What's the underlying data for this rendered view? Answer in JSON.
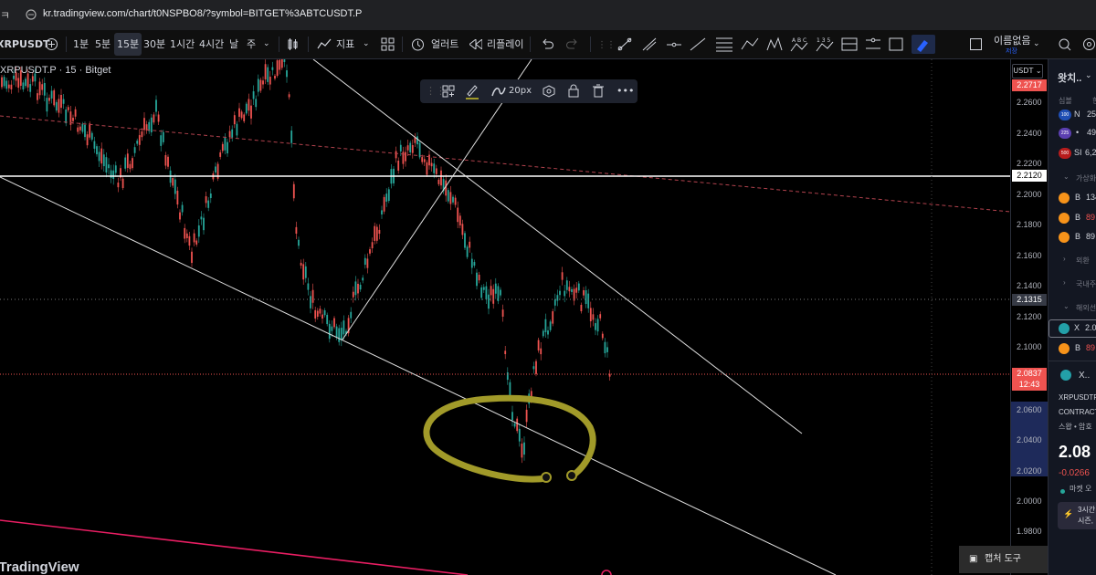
{
  "browser": {
    "back": "ㅋ",
    "url": "kr.tradingview.com/chart/t0NSPBO8/?symbol=BITGET%3ABTCUSDT.P"
  },
  "toolbar": {
    "symbol": "XRPUSDT",
    "intervals": [
      "1분",
      "5분",
      "15분",
      "30분",
      "1시간",
      "4시간",
      "날",
      "주"
    ],
    "selected_interval": "15분",
    "indicators_label": "지표",
    "alert_label": "얼러트",
    "replay_label": "리플레이",
    "layout_name": "이름없음",
    "layout_sub": "저장"
  },
  "chart": {
    "title": "XRPUSDT.P · 15 · Bitget",
    "currency": "USDT",
    "floating_toolbar": {
      "width_label": "20px"
    },
    "axis_ticks": [
      "2.2600",
      "2.2400",
      "2.2200",
      "2.2000",
      "2.1800",
      "2.1600",
      "2.1400",
      "2.1200",
      "2.1000",
      "2.0600",
      "2.0400",
      "2.0200",
      "2.0000",
      "1.9800"
    ],
    "price_labels": {
      "top": "2.2717",
      "hline": "2.2120",
      "crosshair": "2.1315",
      "last": "2.0837",
      "countdown": "12:43"
    },
    "colors": {
      "up": "#26a69a",
      "down": "#ef5350",
      "highlight": "#a19a29",
      "hline": "#ffffff",
      "dashed": "#b2424d",
      "pink": "#e91e63"
    }
  },
  "watchlist": {
    "title": "왓치..",
    "column": "심볼",
    "index_rows": [
      {
        "badge": "100",
        "sym": "N",
        "val": "25"
      },
      {
        "badge": "225",
        "sym": "•",
        "val": "49"
      },
      {
        "badge": "500",
        "sym": "SI",
        "val": "6,2"
      }
    ],
    "section_virtual": "가상화",
    "crypto_rows": [
      {
        "sym": "B",
        "val": "134"
      },
      {
        "sym": "B",
        "val": "89"
      },
      {
        "sym": "B",
        "val": "89"
      }
    ],
    "section_fx": "외환",
    "section_domestic": "국내주",
    "section_foreign": "해외선",
    "foreign_rows": [
      {
        "sym": "X",
        "val": "2.0"
      },
      {
        "sym": "B",
        "val": "89"
      }
    ],
    "detail": {
      "sym": "X..",
      "name": "XRPUSDTP",
      "type": "CONTRACT",
      "exchange": "스왑 • 암호",
      "price": "2.08",
      "change": "-0.0266",
      "status": "마켓 오",
      "promo_line1": "3시간",
      "promo_line2": "시즌,"
    }
  },
  "taskbar": {
    "capture_label": "캡처 도구"
  },
  "branding": {
    "logo": "TradingView"
  }
}
